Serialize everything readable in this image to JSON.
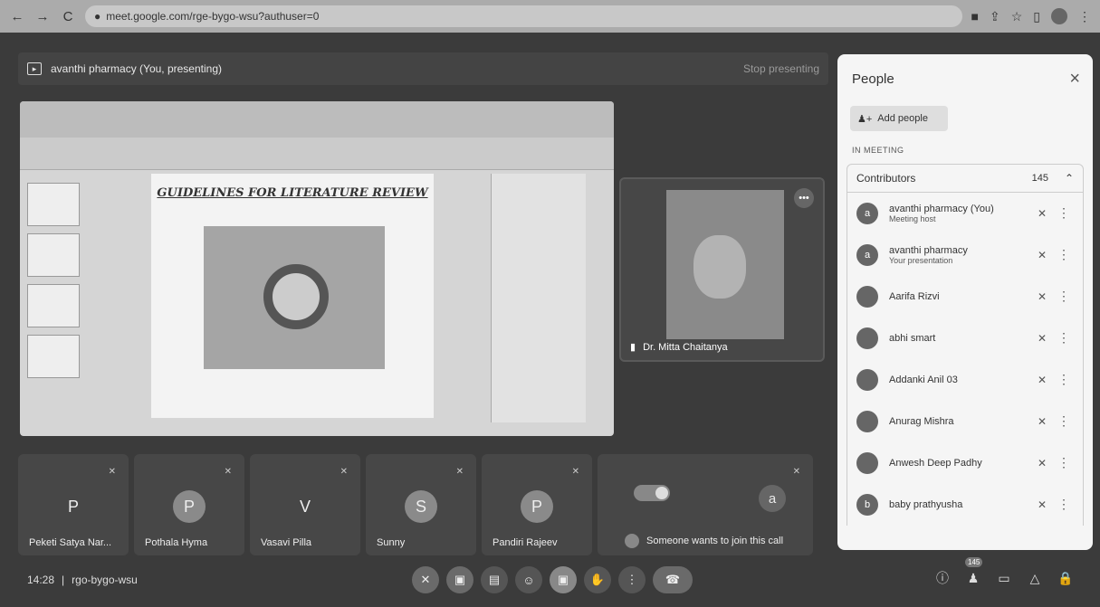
{
  "browser": {
    "url": "meet.google.com/rge-bygo-wsu?authuser=0"
  },
  "present": {
    "label": "avanthi pharmacy (You, presenting)",
    "stop": "Stop presenting"
  },
  "slide": {
    "title": "GUIDELINES FOR LITERATURE REVIEW"
  },
  "main_video": {
    "name": "Dr. Mitta Chaitanya"
  },
  "tiles": [
    {
      "letter": "P",
      "name": "Peketi Satya Nar..."
    },
    {
      "letter": "P",
      "name": "Pothala Hyma"
    },
    {
      "letter": "V",
      "name": "Vasavi Pilla"
    },
    {
      "letter": "S",
      "name": "Sunny"
    },
    {
      "letter": "P",
      "name": "Pandiri Rajeev"
    }
  ],
  "join_tile": {
    "text": "Someone wants to join this call",
    "letter": "a"
  },
  "people": {
    "title": "People",
    "add": "Add people",
    "section": "IN MEETING",
    "group": "Contributors",
    "count": "145",
    "rows": [
      {
        "initial": "a",
        "name": "avanthi pharmacy (You)",
        "sub": "Meeting host"
      },
      {
        "initial": "a",
        "name": "avanthi pharmacy",
        "sub": "Your presentation"
      },
      {
        "initial": "",
        "name": "Aarifa Rizvi",
        "sub": ""
      },
      {
        "initial": "",
        "name": "abhi smart",
        "sub": ""
      },
      {
        "initial": "",
        "name": "Addanki Anil 03",
        "sub": ""
      },
      {
        "initial": "",
        "name": "Anurag Mishra",
        "sub": ""
      },
      {
        "initial": "",
        "name": "Anwesh Deep Padhy",
        "sub": ""
      },
      {
        "initial": "b",
        "name": "baby prathyusha",
        "sub": ""
      }
    ]
  },
  "bottom": {
    "time": "14:28",
    "code": "rgo-bygo-wsu",
    "people_badge": "145"
  }
}
